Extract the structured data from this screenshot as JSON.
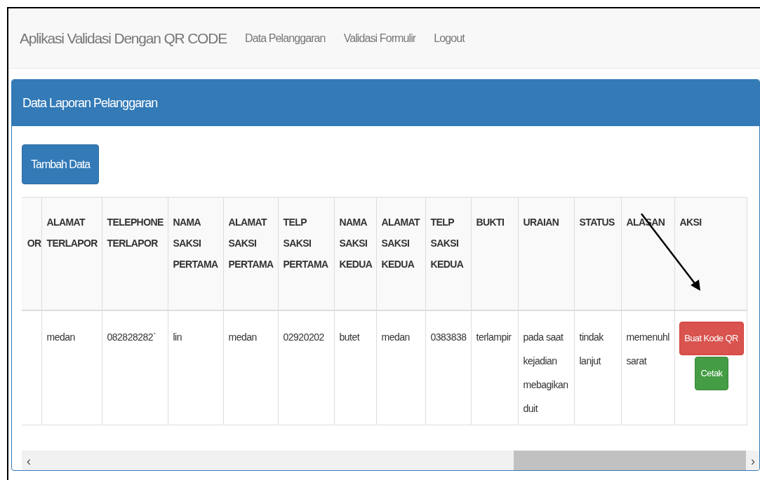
{
  "navbar": {
    "brand": "Aplikasi Validasi Dengan QR CODE",
    "links": [
      "Data Pelanggaran",
      "Validasi Formulir",
      "Logout"
    ]
  },
  "panel": {
    "title": "Data Laporan Pelanggaran",
    "add_button": "Tambah Data",
    "table": {
      "columns": [
        "OR",
        "ALAMAT\nTERLAPOR",
        "TELEPHONE\nTERLAPOR",
        "NAMA\nSAKSI\nPERTAMA",
        "ALAMAT\nSAKSI\nPERTAMA",
        "TELP\nSAKSI\nPERTAMA",
        "NAMA\nSAKSI\nKEDUA",
        "ALAMAT\nSAKSI\nKEDUA",
        "TELP\nSAKSI\nKEDUA",
        "BUKTI",
        "URAIAN",
        "STATUS",
        "ALASAN",
        "AKSI"
      ],
      "rows": [
        {
          "cells": [
            "",
            "medan",
            "082828282`",
            "lin",
            "medan",
            "02920202",
            "butet",
            "medan",
            "0383838",
            "terlampir",
            "pada saat kejadian mebagikan duit",
            "tindak lanjut",
            "memenuhl sarat"
          ],
          "actions": [
            {
              "label": "Buat Kode QR",
              "kind": "danger"
            },
            {
              "label": "Cetak",
              "kind": "success"
            }
          ]
        }
      ]
    },
    "scrollbar": {
      "left": "‹",
      "right": "›"
    }
  }
}
